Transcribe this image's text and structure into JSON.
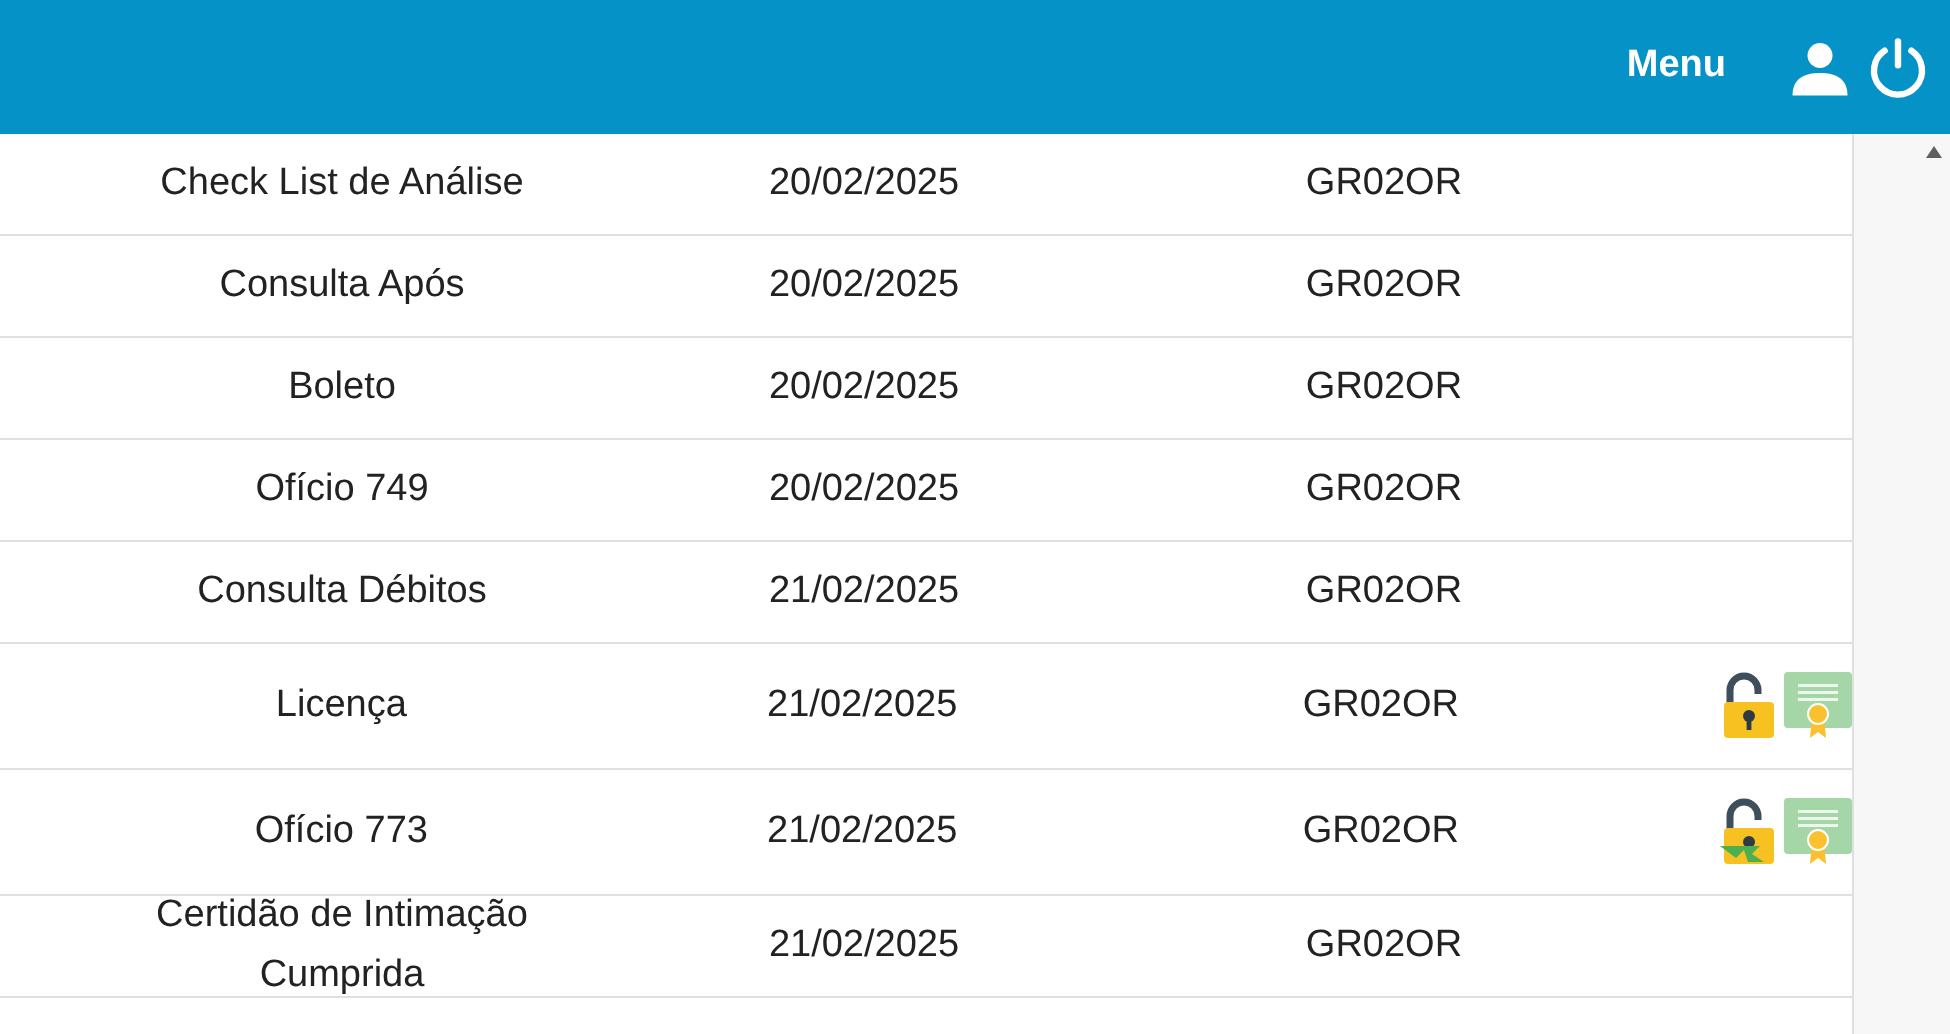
{
  "header": {
    "menu_label": "Menu"
  },
  "rows": [
    {
      "name": "Check List de Análise",
      "date": "20/02/2025",
      "code": "GR02OR",
      "icons": []
    },
    {
      "name": "Consulta Após",
      "date": "20/02/2025",
      "code": "GR02OR",
      "icons": []
    },
    {
      "name": "Boleto",
      "date": "20/02/2025",
      "code": "GR02OR",
      "icons": []
    },
    {
      "name": "Ofício 749",
      "date": "20/02/2025",
      "code": "GR02OR",
      "icons": []
    },
    {
      "name": "Consulta Débitos",
      "date": "21/02/2025",
      "code": "GR02OR",
      "icons": []
    },
    {
      "name": "Licença",
      "date": "21/02/2025",
      "code": "GR02OR",
      "icons": [
        {
          "kind": "padlock"
        },
        {
          "kind": "certificate"
        }
      ]
    },
    {
      "name": "Ofício 773",
      "date": "21/02/2025",
      "code": "GR02OR",
      "icons": [
        {
          "kind": "padlock-arrow"
        },
        {
          "kind": "certificate"
        }
      ]
    },
    {
      "name": "Certidão de Intimação Cumprida",
      "date": "21/02/2025",
      "code": "GR02OR",
      "icons": []
    }
  ]
}
